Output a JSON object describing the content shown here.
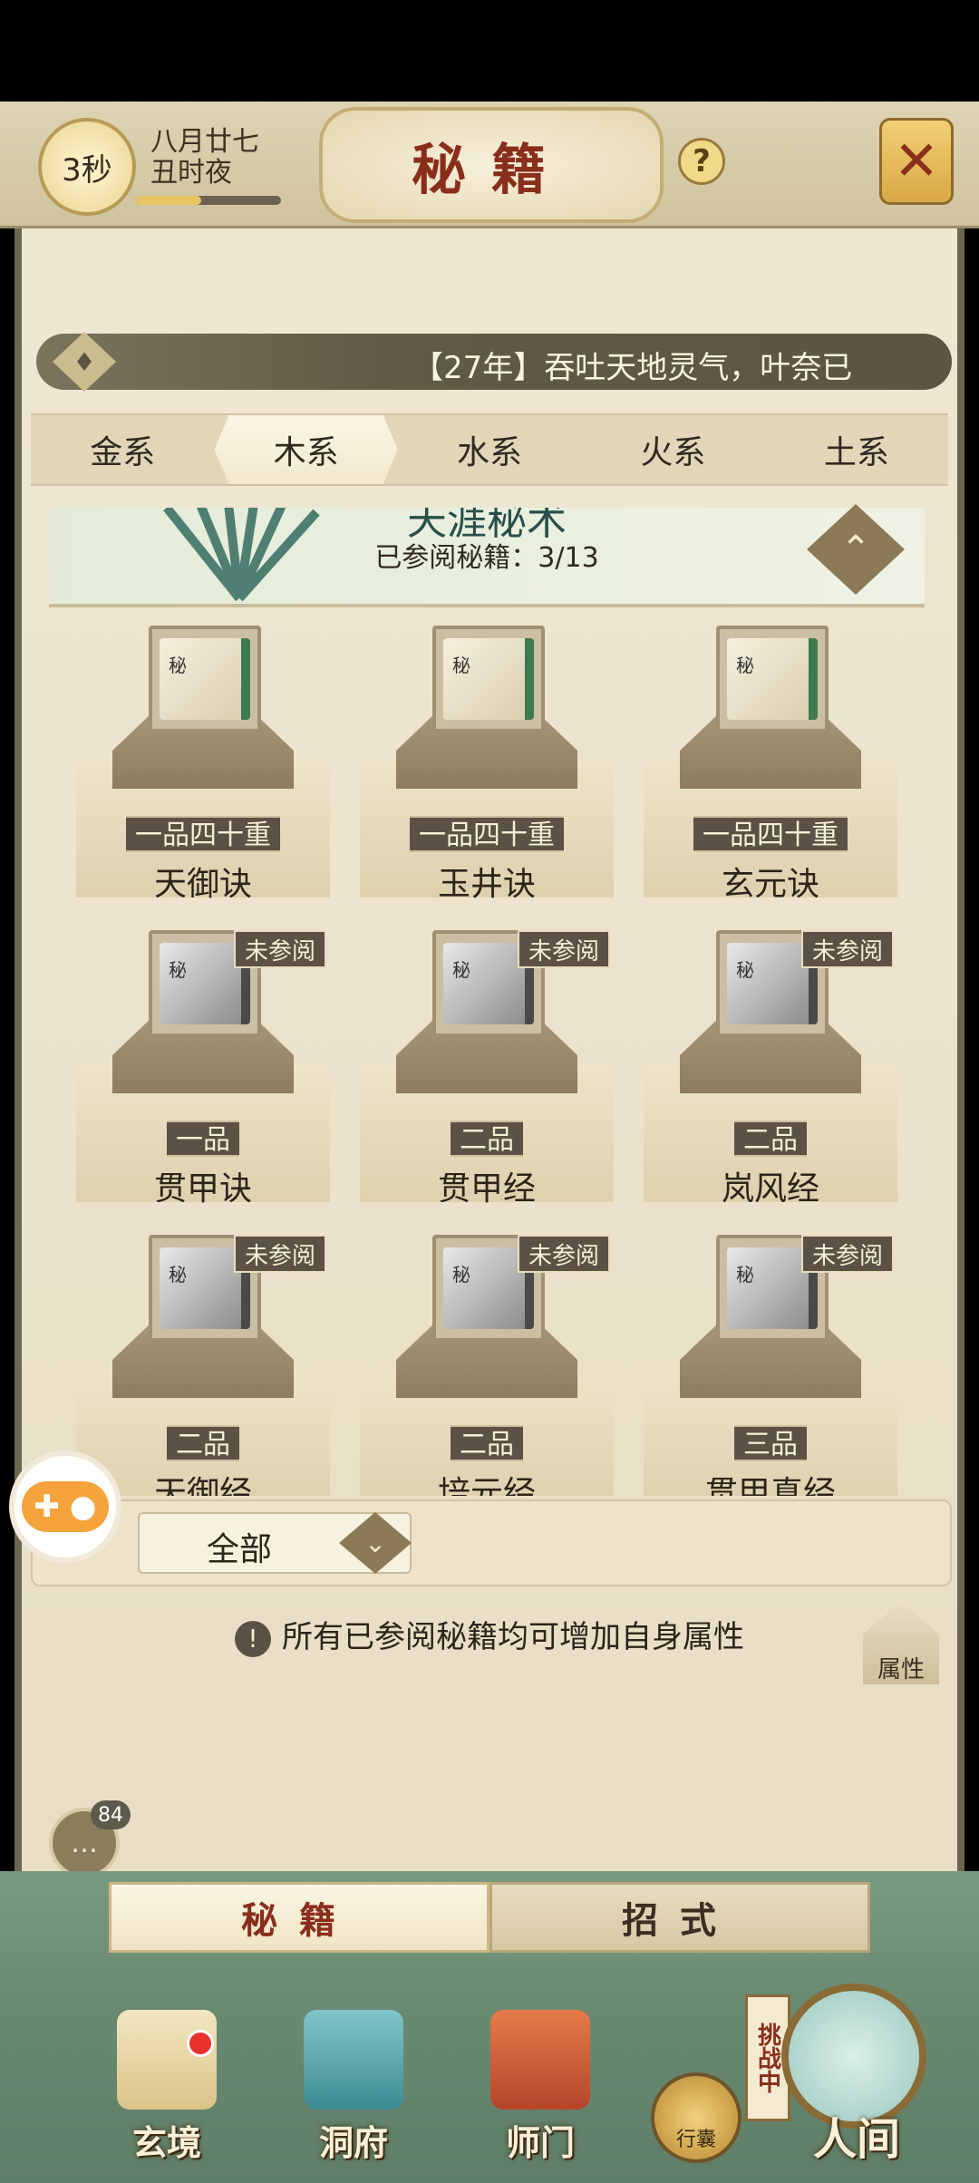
{
  "header": {
    "timer": "3秒",
    "date_line1": "八月廿七",
    "date_line2": "丑时夜",
    "time_progress": 0.45,
    "title": "秘籍",
    "help_icon": "question-icon",
    "close_icon": "close-x-icon"
  },
  "log": {
    "text": "【27年】吞吐天地灵气，叶奈已"
  },
  "element_tabs": [
    {
      "label": "金系",
      "active": false
    },
    {
      "label": "木系",
      "active": true
    },
    {
      "label": "水系",
      "active": false
    },
    {
      "label": "火系",
      "active": false
    },
    {
      "label": "土系",
      "active": false
    }
  ],
  "school": {
    "name": "天涯秘术",
    "count": "已参阅秘籍：3/13"
  },
  "books": [
    {
      "rank": "一品四十重",
      "name": "天御诀",
      "tag": "",
      "state": "read",
      "mark": "秘"
    },
    {
      "rank": "一品四十重",
      "name": "玉井诀",
      "tag": "",
      "state": "read",
      "mark": "秘"
    },
    {
      "rank": "一品四十重",
      "name": "玄元诀",
      "tag": "",
      "state": "read",
      "mark": "秘"
    },
    {
      "rank": "一品",
      "name": "贯甲诀",
      "tag": "未参阅",
      "state": "unread",
      "mark": "秘"
    },
    {
      "rank": "二品",
      "name": "贯甲经",
      "tag": "未参阅",
      "state": "unread",
      "mark": "秘"
    },
    {
      "rank": "二品",
      "name": "岚风经",
      "tag": "未参阅",
      "state": "unread",
      "mark": "秘"
    },
    {
      "rank": "二品",
      "name": "天御经",
      "tag": "未参阅",
      "state": "unread",
      "mark": "秘"
    },
    {
      "rank": "二品",
      "name": "培元经",
      "tag": "未参阅",
      "state": "unread",
      "mark": "秘"
    },
    {
      "rank": "三品",
      "name": "贯甲真经",
      "tag": "未参阅",
      "state": "unread",
      "mark": "秘"
    }
  ],
  "filter": {
    "label": "全部"
  },
  "hint": {
    "icon": "!",
    "text": "所有已参阅秘籍均可增加自身属性"
  },
  "attr_button": "属性",
  "chat": {
    "badge": "84"
  },
  "sub_tabs": [
    {
      "label": "秘籍",
      "active": true
    },
    {
      "label": "招式",
      "active": false
    }
  ],
  "nav": {
    "xuanjing": "玄境",
    "dongfu": "洞府",
    "shimen": "师门",
    "bag": "行囊",
    "challenge": "挑战中",
    "renjian": "人间"
  }
}
